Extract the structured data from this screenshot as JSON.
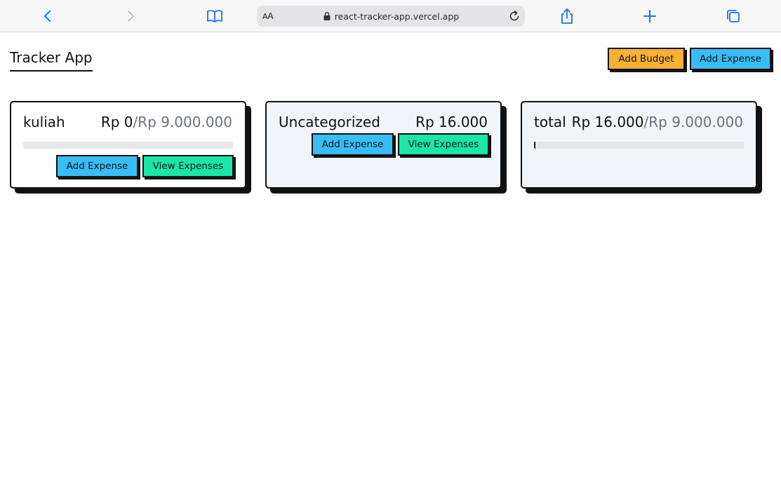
{
  "browser": {
    "reader_label_small": "A",
    "reader_label_big": "A",
    "url": "react-tracker-app.vercel.app"
  },
  "app": {
    "title": "Tracker App",
    "add_budget_label": "Add Budget",
    "add_expense_label": "Add Expense"
  },
  "cards": [
    {
      "name": "kuliah",
      "current": "Rp 0",
      "max": "/Rp 9.000.000",
      "progress_fraction": 0.0,
      "add_expense_label": "Add Expense",
      "view_expenses_label": "View Expenses"
    },
    {
      "name": "Uncategorized",
      "current": "Rp 16.000",
      "max": "",
      "add_expense_label": "Add Expense",
      "view_expenses_label": "View Expenses"
    },
    {
      "name": "total",
      "current": "Rp 16.000",
      "max": "/Rp 9.000.000",
      "progress_fraction": 0.0018
    }
  ],
  "colors": {
    "budget_button": "#fbb034",
    "expense_button": "#38bdf8",
    "view_button": "#19e6a7",
    "progress_track": "#e5e7eb",
    "max_text": "#6b7280"
  },
  "icons": [
    "back-icon",
    "forward-icon",
    "bookmarks-icon",
    "lock-icon",
    "reload-icon",
    "share-icon",
    "new-tab-icon",
    "tabs-icon"
  ]
}
